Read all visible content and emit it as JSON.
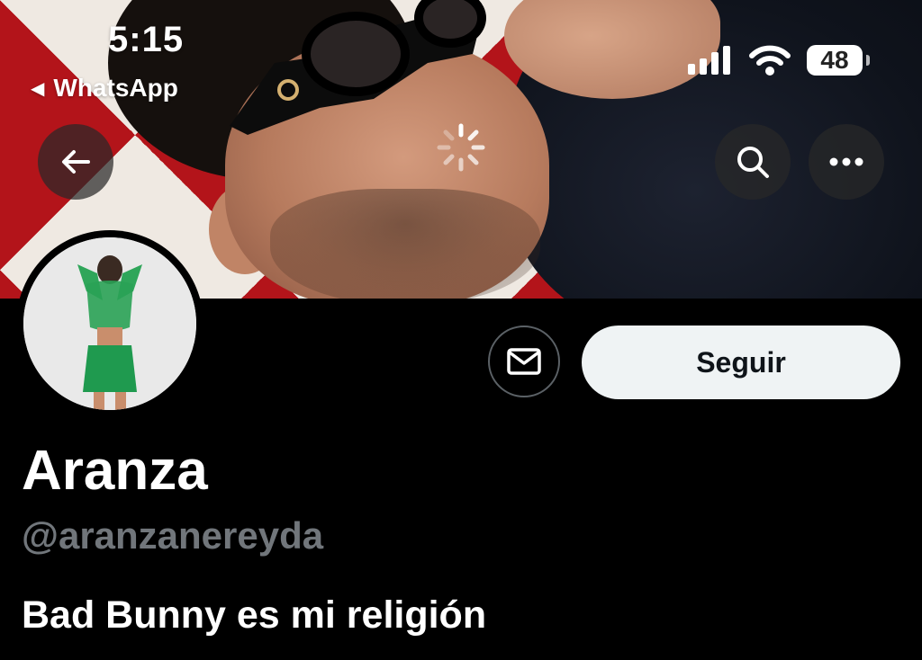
{
  "status_bar": {
    "time": "5:15",
    "back_app": "WhatsApp",
    "battery": "48"
  },
  "header": {
    "back_icon": "arrow-left-icon",
    "search_icon": "search-icon",
    "more_icon": "more-horizontal-icon"
  },
  "profile": {
    "display_name": "Aranza",
    "handle": "@aranzanereyda",
    "bio": "Bad Bunny es mi religión",
    "follow_label": "Seguir",
    "message_icon": "mail-icon"
  },
  "colors": {
    "background": "#000000",
    "follow_button_bg": "#eff3f4",
    "handle_text": "#71767b"
  }
}
